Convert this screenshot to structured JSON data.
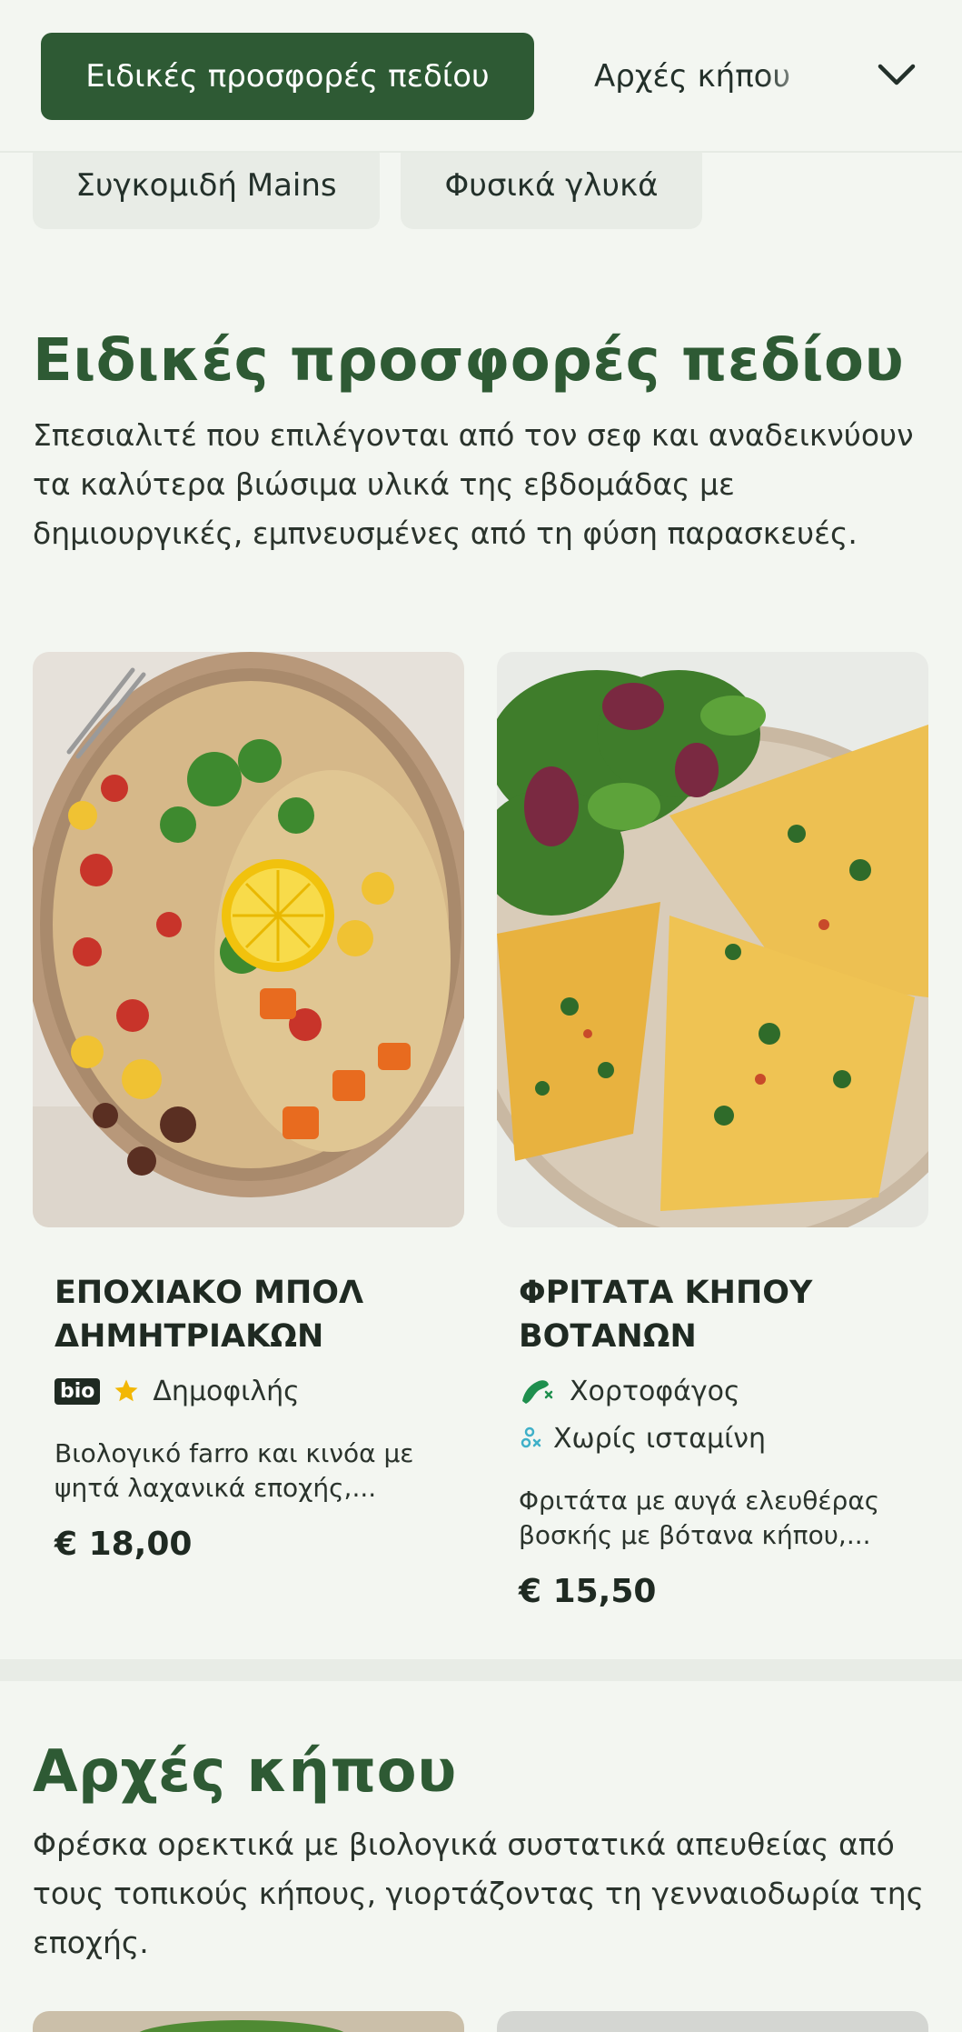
{
  "nav": {
    "active_tab": "Ειδικές προσφορές πεδίου",
    "next_tab": "Αρχές κήπου",
    "chevron_icon": "chevron-down-icon"
  },
  "chips": [
    {
      "label": "Συγκομιδή Mains"
    },
    {
      "label": "Φυσικά γλυκά"
    }
  ],
  "section_specials": {
    "title": "Ειδικές προσφορές πεδίου",
    "description": "Σπεσιαλιτέ που επιλέγονται από τον σεφ και αναδεικνύουν τα καλύτερα βιώσιμα υλικά της εβδομάδας με δημιουργικές, εμπνευσμένες από τη φύση παρασκευές."
  },
  "cards": [
    {
      "name": "ΕΠΟΧΙΑΚΟ ΜΠΟΛ ΔΗΜΗΤΡΙΑΚΩΝ",
      "badge": "bio",
      "tag_icon": "star-icon",
      "tag": "Δημοφιλής",
      "description": "Βιολογικό farro και κινόα με ψητά λαχανικά εποχής,...",
      "price": "€ 18,00"
    },
    {
      "name": "ΦΡΙΤΑΤΑ ΚΗΠΟΥ ΒΟΤΑΝΩΝ",
      "tags": [
        {
          "icon": "vegetarian-icon",
          "label": "Χορτοφάγος"
        },
        {
          "icon": "gluten-free-icon",
          "label": "Χωρίς ισταμίνη"
        }
      ],
      "description": "Φριτάτα με αυγά ελευθέρας βοσκής με βότανα κήπου,...",
      "price": "€ 15,50"
    }
  ],
  "section_garden": {
    "title": "Αρχές κήπου",
    "description": "Φρέσκα ορεκτικά με βιολογικά συστατικά απευθείας από τους τοπικούς κήπους, γιορτάζοντας τη γενναιοδωρία της εποχής."
  },
  "colors": {
    "brand": "#2e5a34",
    "background": "#f3f6f1",
    "chip": "#e8ece6",
    "star": "#f2b705",
    "veg": "#1f8f4e",
    "gluten_free": "#3fb0c8"
  }
}
